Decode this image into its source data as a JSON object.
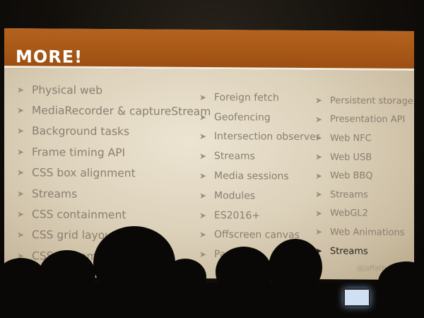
{
  "slide": {
    "title": "MORE!",
    "handle": "@jaffathecake",
    "columns": [
      {
        "items": [
          {
            "label": "Physical web"
          },
          {
            "label": "MediaRecorder & captureStream"
          },
          {
            "label": "Background tasks"
          },
          {
            "label": "Frame timing API"
          },
          {
            "label": "CSS box alignment"
          },
          {
            "label": "Streams"
          },
          {
            "label": "CSS containment"
          },
          {
            "label": "CSS grid layout"
          },
          {
            "label": "CSS custom"
          }
        ]
      },
      {
        "items": [
          {
            "label": "Foreign fetch"
          },
          {
            "label": "Geofencing"
          },
          {
            "label": "Intersection observer"
          },
          {
            "label": "Streams"
          },
          {
            "label": "Media sessions"
          },
          {
            "label": "Modules"
          },
          {
            "label": "ES2016+"
          },
          {
            "label": "Offscreen canvas"
          },
          {
            "label": "Payments"
          }
        ]
      },
      {
        "items": [
          {
            "label": "Persistent storage"
          },
          {
            "label": "Presentation API"
          },
          {
            "label": "Web NFC"
          },
          {
            "label": "Web USB"
          },
          {
            "label": "Web BBQ"
          },
          {
            "label": "Streams"
          },
          {
            "label": "WebGL2"
          },
          {
            "label": "Web Animations"
          },
          {
            "label": "Streams",
            "highlighted": true
          }
        ]
      }
    ]
  },
  "icons": {
    "bullet": "arrow-bullet-icon"
  },
  "colors": {
    "title_bar": "#a65716",
    "slide_bg": "#e3d9c5",
    "item_text": "#8a7e70",
    "highlight_text": "#2a2622"
  }
}
